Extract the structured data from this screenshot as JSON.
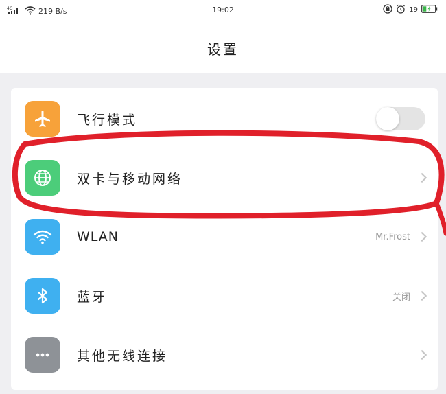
{
  "status_bar": {
    "network": "4G",
    "speed": "219 B/s",
    "time": "19:02",
    "battery_percent": "19"
  },
  "header": {
    "title": "设置"
  },
  "settings": {
    "items": [
      {
        "label": "飞行模式",
        "icon": "airplane-icon",
        "icon_color": "#f7a23a",
        "control": "toggle",
        "toggle_on": false
      },
      {
        "label": "双卡与移动网络",
        "icon": "globe-icon",
        "icon_color": "#4ccd7a",
        "control": "chevron"
      },
      {
        "label": "WLAN",
        "icon": "wifi-icon",
        "icon_color": "#3fb0f0",
        "value": "Mr.Frost",
        "control": "chevron"
      },
      {
        "label": "蓝牙",
        "icon": "bluetooth-icon",
        "icon_color": "#3fb0f0",
        "value": "关闭",
        "control": "chevron"
      },
      {
        "label": "其他无线连接",
        "icon": "more-icon",
        "icon_color": "#8e9297",
        "control": "chevron"
      }
    ]
  },
  "colors": {
    "annotation": "#e0202a",
    "background": "#efeff2"
  }
}
